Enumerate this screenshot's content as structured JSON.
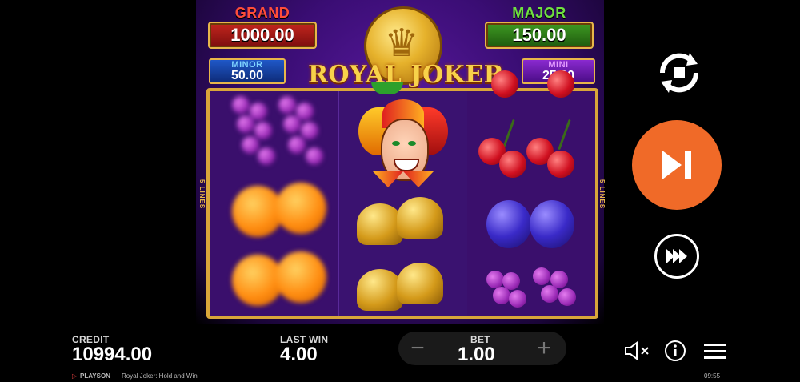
{
  "jackpots": {
    "grand": {
      "label": "GRAND",
      "value": "1000.00"
    },
    "major": {
      "label": "MAJOR",
      "value": "150.00"
    },
    "minor": {
      "label": "MINOR",
      "value": "50.00"
    },
    "mini": {
      "label": "MINI",
      "value": "25.00"
    }
  },
  "logo": {
    "text": "ROYAL JOKER"
  },
  "reels": {
    "lines_label": "5 LINES"
  },
  "bottom": {
    "credit_label": "CREDIT",
    "credit_value": "10994.00",
    "last_win_label": "LAST WIN",
    "last_win_value": "4.00",
    "bet_label": "BET",
    "bet_value": "1.00",
    "bet_minus": "−",
    "bet_plus": "+"
  },
  "footer": {
    "brand": "PLAYSON",
    "game_title": "Royal Joker: Hold and Win",
    "clock": "09:55"
  },
  "icons": {
    "autoplay": "autoplay-icon",
    "spin": "spin-icon",
    "turbo": "turbo-icon",
    "sound": "sound-muted-icon",
    "info": "info-icon",
    "menu": "menu-icon"
  },
  "colors": {
    "spin_button": "#f06a28",
    "background_purple": "#3a0d74",
    "frame_gold": "#d9a63a"
  }
}
